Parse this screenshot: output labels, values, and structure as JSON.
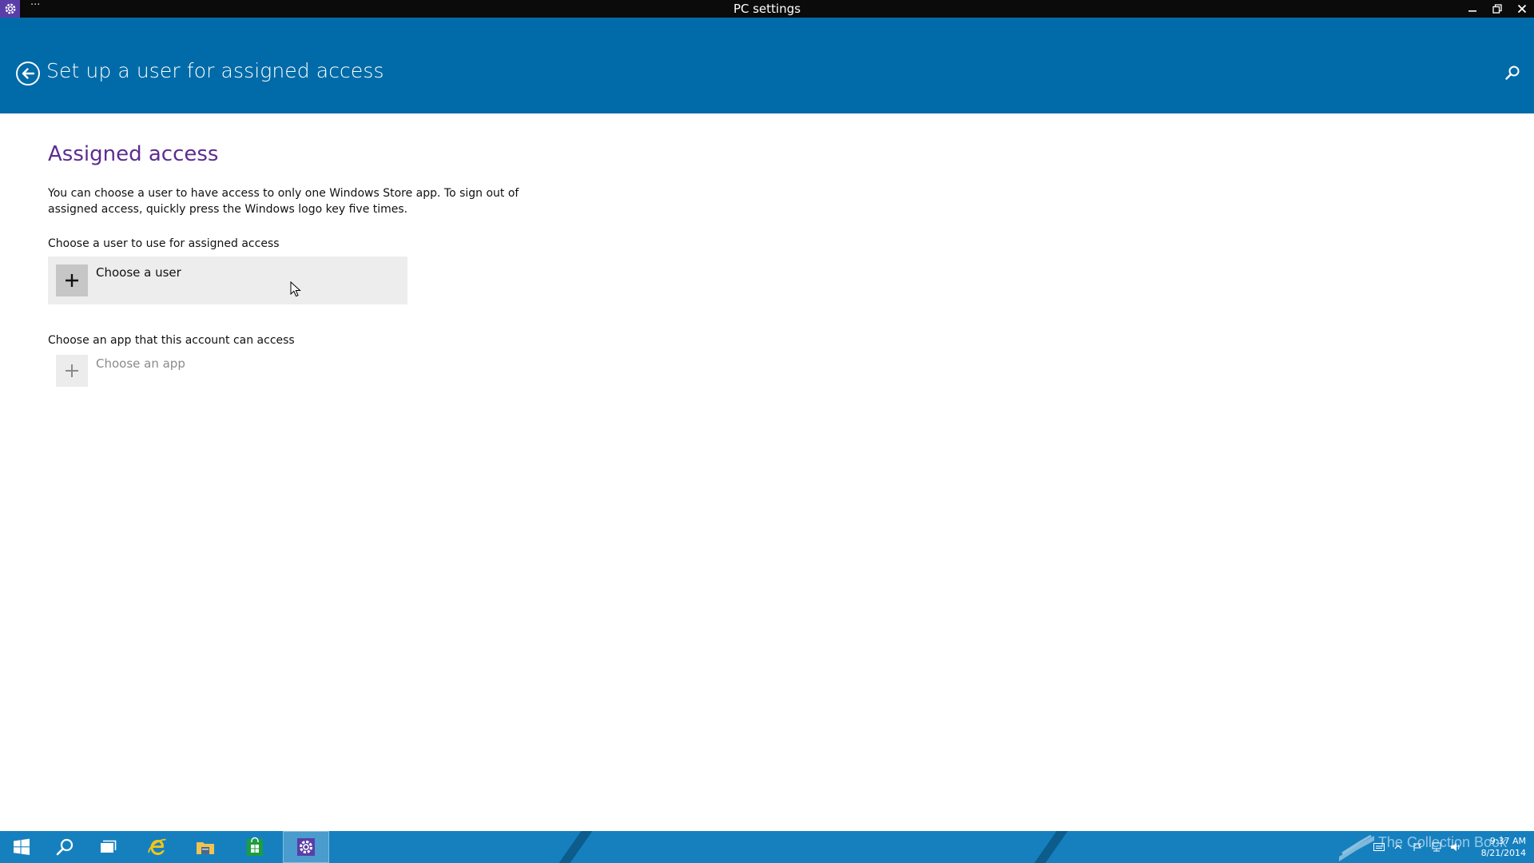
{
  "window": {
    "title": "PC settings",
    "menu_label": "···"
  },
  "header": {
    "title": "Set up a user for assigned access"
  },
  "content": {
    "section_title": "Assigned access",
    "description": "You can choose a user to have access to only one Windows Store app. To sign out of assigned access, quickly press the Windows logo key five times.",
    "user_label": "Choose a user to use for assigned access",
    "choose_user": "Choose a user",
    "app_label": "Choose an app that this account can access",
    "choose_app": "Choose an app"
  },
  "taskbar": {
    "items": [
      {
        "icon": "windows-logo-icon"
      },
      {
        "icon": "search-icon"
      },
      {
        "icon": "task-view-icon"
      },
      {
        "icon": "internet-explorer-icon"
      },
      {
        "icon": "file-explorer-icon"
      },
      {
        "icon": "store-icon"
      },
      {
        "icon": "settings-icon",
        "active": true
      }
    ],
    "watermark": "The Collection Book",
    "clock_time": "9:37 AM",
    "clock_date": "8/21/2014"
  },
  "colors": {
    "header": "#006ba8",
    "accent_title": "#5c2d91",
    "taskbar": "#1680bf",
    "titlebar": "#0b0b0b"
  }
}
